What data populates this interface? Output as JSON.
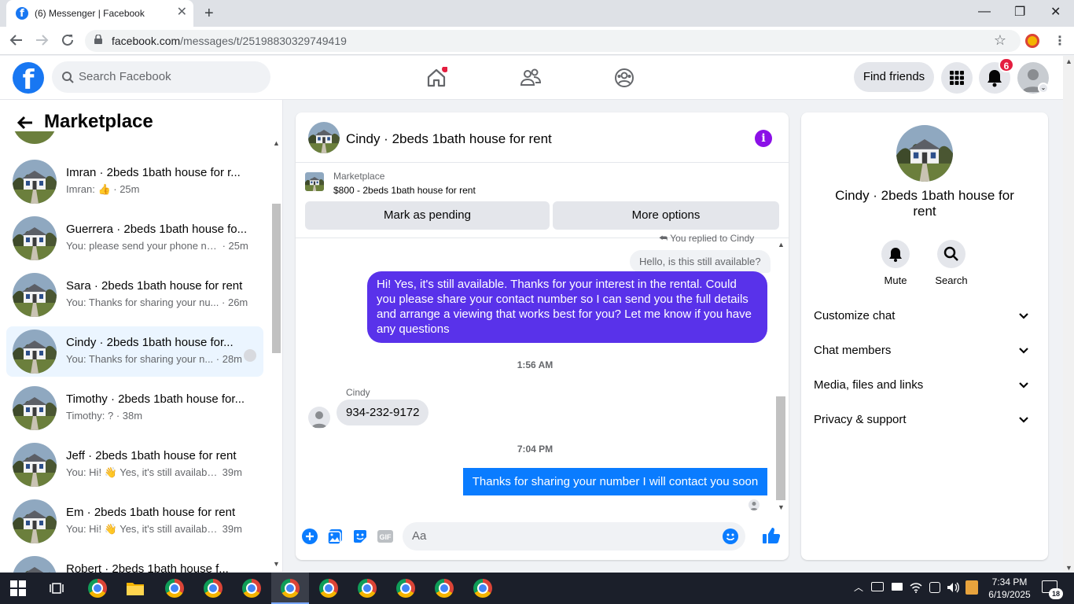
{
  "browser": {
    "tab_title": "(6) Messenger | Facebook",
    "url_domain": "facebook.com",
    "url_path": "/messages/t/25198830329749419"
  },
  "fb_header": {
    "search_placeholder": "Search Facebook",
    "find_friends_label": "Find friends",
    "notification_count": "6"
  },
  "sidebar": {
    "title": "Marketplace",
    "conversations": [
      {
        "name": "Imran · 2beds 1bath house for r...",
        "preview": "Imran: 👍",
        "time": " · 25m",
        "selected": false
      },
      {
        "name": "Guerrera · 2beds 1bath house fo...",
        "preview": "You: please send your phone nu...",
        "time": " · 25m",
        "selected": false
      },
      {
        "name": "Sara · 2beds 1bath house for rent",
        "preview": "You: Thanks for sharing your nu...",
        "time": " · 26m",
        "selected": false
      },
      {
        "name": "Cindy · 2beds 1bath house for...",
        "preview": "You: Thanks for sharing your n...",
        "time": " · 28m",
        "selected": true
      },
      {
        "name": "Timothy · 2beds 1bath house for...",
        "preview": "Timothy: ?",
        "time": " · 38m",
        "selected": false
      },
      {
        "name": "Jeff · 2beds 1bath house for rent",
        "preview": "You: Hi! 👋 Yes, it's still available....",
        "time": " 39m",
        "selected": false
      },
      {
        "name": "Em · 2beds 1bath house for rent",
        "preview": "You: Hi! 👋 Yes, it's still available....",
        "time": " 39m",
        "selected": false
      },
      {
        "name": "Robert · 2beds 1bath house f...",
        "preview": "",
        "time": "",
        "selected": false
      }
    ]
  },
  "chat": {
    "title": "Cindy · 2beds 1bath house for rent",
    "listing_source": "Marketplace",
    "listing_title": "$800 - 2beds 1bath house for rent",
    "mark_pending_label": "Mark as pending",
    "more_options_label": "More options",
    "replied_to": "You replied to Cindy",
    "quoted_message": "Hello, is this still available?",
    "outgoing_1": "Hi! Yes, it's still available. Thanks for your interest in the rental. Could you please share your contact number so I can send you the full details and arrange a viewing that works best for you? Let me know if you have any questions",
    "time_1": "1:56 AM",
    "sender_name": "Cindy",
    "incoming_1": "934-232-9172",
    "time_2": "7:04 PM",
    "outgoing_2": "Thanks for sharing your number I will contact you soon",
    "input_placeholder": "Aa"
  },
  "right_panel": {
    "name": "Cindy · 2beds 1bath house for rent",
    "mute_label": "Mute",
    "search_label": "Search",
    "sections": [
      "Customize chat",
      "Chat members",
      "Media, files and links",
      "Privacy & support"
    ]
  },
  "taskbar": {
    "time": "7:34 PM",
    "date": "6/19/2025",
    "notification_count": "18"
  },
  "colors": {
    "fb_blue": "#1877f2",
    "message_purple": "#5932ea",
    "outgoing_blue": "#0a7cff",
    "info_purple": "#8b10e7",
    "badge_red": "#e41e3f"
  }
}
